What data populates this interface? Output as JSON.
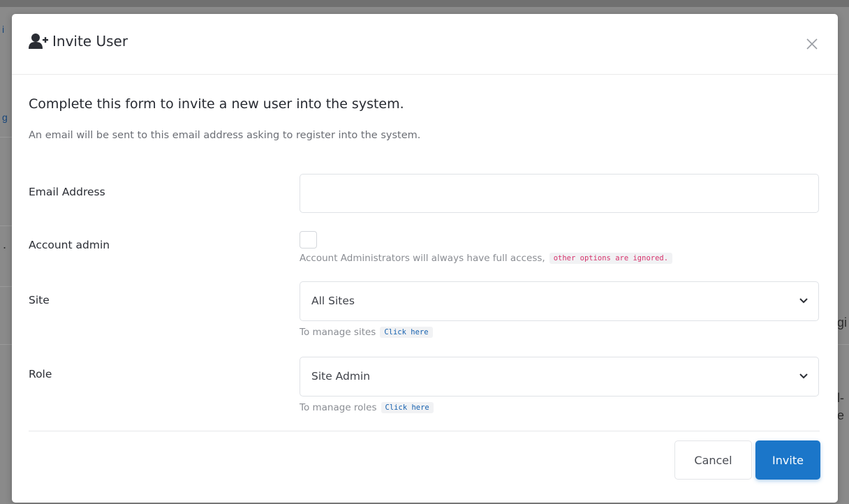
{
  "background": {
    "fragments": [
      "i",
      "g",
      ".",
      "gi",
      "l-",
      "e"
    ]
  },
  "modal": {
    "title": "Invite User",
    "title_icon": "user-plus-icon",
    "close_icon": "close-icon",
    "heading": "Complete this form to invite a new user into the system.",
    "subheading": "An email will be sent to this email address asking to register into the system."
  },
  "form": {
    "email": {
      "label": "Email Address",
      "value": "",
      "placeholder": ""
    },
    "account_admin": {
      "label": "Account admin",
      "checked": false,
      "help_text": "Account Administrators will always have full access,",
      "help_code": "other options are ignored."
    },
    "site": {
      "label": "Site",
      "selected": "All Sites",
      "help_text": "To manage sites",
      "help_link": "Click here"
    },
    "role": {
      "label": "Role",
      "selected": "Site Admin",
      "help_text": "To manage roles",
      "help_link": "Click here"
    }
  },
  "footer": {
    "cancel_label": "Cancel",
    "invite_label": "Invite"
  },
  "colors": {
    "primary": "#1b76c9",
    "code_pink": "#d6336c",
    "link_blue": "#1762b0"
  }
}
